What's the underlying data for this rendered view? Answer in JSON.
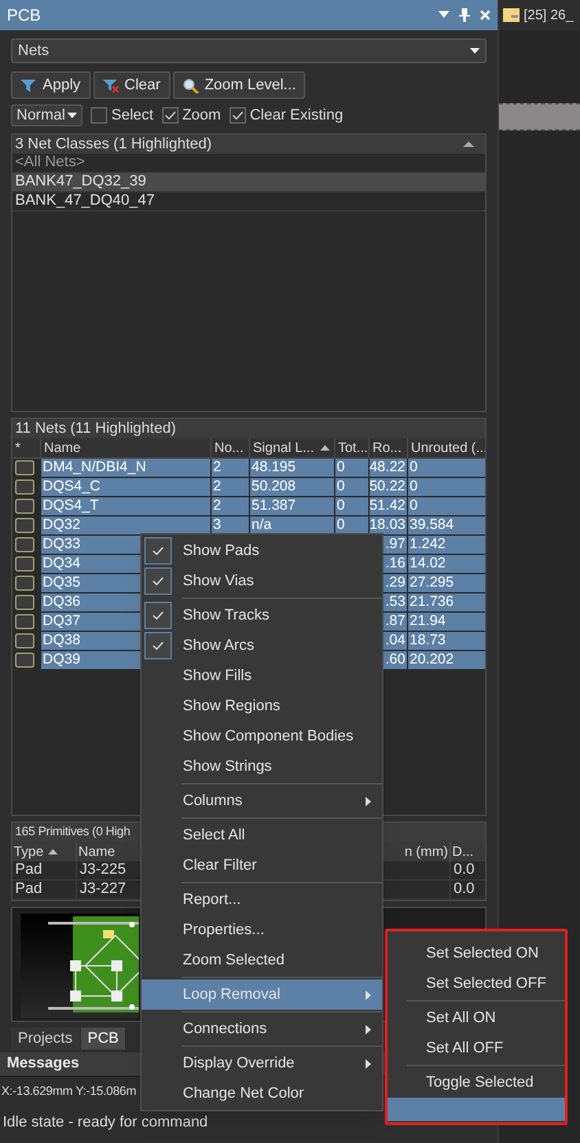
{
  "panel": {
    "title": "PCB"
  },
  "document_tab": {
    "label": "[25] 26_"
  },
  "mode_dropdown": {
    "value": "Nets"
  },
  "toolbar": [
    {
      "kind": "apply",
      "label": "Apply"
    },
    {
      "kind": "clear",
      "label": "Clear"
    },
    {
      "kind": "zoom",
      "label": "Zoom Level..."
    }
  ],
  "highlight_dropdown": {
    "value": "Normal"
  },
  "options": [
    {
      "label": "Select",
      "checked": false
    },
    {
      "label": "Zoom",
      "checked": true
    },
    {
      "label": "Clear Existing",
      "checked": true
    }
  ],
  "net_classes": {
    "header": "3 Net Classes (1 Highlighted)",
    "items": [
      {
        "label": "<All Nets>",
        "dimmed": true,
        "selected": false
      },
      {
        "label": "BANK47_DQ32_39",
        "dimmed": false,
        "selected": true
      },
      {
        "label": "BANK_47_DQ40_47",
        "dimmed": false,
        "selected": false
      }
    ]
  },
  "nets": {
    "header": "11 Nets (11 Highlighted)",
    "columns": [
      {
        "label": "*",
        "sorted": false
      },
      {
        "label": "Name",
        "sorted": false
      },
      {
        "label": "No...",
        "sorted": false
      },
      {
        "label": "Signal L...",
        "sorted": true
      },
      {
        "label": "Tot...",
        "sorted": false
      },
      {
        "label": "Ro...",
        "sorted": false
      },
      {
        "label": "Unrouted (...",
        "sorted": false
      }
    ],
    "rows": [
      {
        "name": "DM4_N/DBI4_N",
        "nodes": "2",
        "signal": "48.195",
        "total": "0",
        "ro": "48.22",
        "unrouted": "0",
        "selected": true
      },
      {
        "name": "DQS4_C",
        "nodes": "2",
        "signal": "50.208",
        "total": "0",
        "ro": "50.22",
        "unrouted": "0",
        "selected": true
      },
      {
        "name": "DQS4_T",
        "nodes": "2",
        "signal": "51.387",
        "total": "0",
        "ro": "51.42",
        "unrouted": "0",
        "selected": true
      },
      {
        "name": "DQ32",
        "nodes": "3",
        "signal": "n/a",
        "total": "0",
        "ro": "18.03",
        "unrouted": "39.584",
        "selected": true
      },
      {
        "name": "DQ33",
        "ro": ".97",
        "unrouted": "1.242",
        "selected": true
      },
      {
        "name": "DQ34",
        "ro": ".16",
        "unrouted": "14.02",
        "selected": true
      },
      {
        "name": "DQ35",
        "ro": ".29",
        "unrouted": "27.295",
        "selected": true
      },
      {
        "name": "DQ36",
        "ro": ".53",
        "unrouted": "21.736",
        "selected": true
      },
      {
        "name": "DQ37",
        "ro": ".87",
        "unrouted": "21.94",
        "selected": true
      },
      {
        "name": "DQ38",
        "ro": ".04",
        "unrouted": "18.73",
        "selected": true
      },
      {
        "name": "DQ39",
        "ro": ".60",
        "unrouted": "20.202",
        "selected": true
      }
    ]
  },
  "primitives": {
    "header": "165 Primitives (0 High",
    "columns": [
      {
        "label": "Type",
        "sorted": true
      },
      {
        "label": "Name",
        "sorted": false
      },
      {
        "label": "n (mm)",
        "sorted": false
      },
      {
        "label": "D...",
        "sorted": false
      }
    ],
    "rows": [
      {
        "type": "Pad",
        "name": "J3-225",
        "column_4": "0.0"
      },
      {
        "type": "Pad",
        "name": "J3-227",
        "column_4": "0.0"
      }
    ]
  },
  "bottom_tabs": [
    {
      "label": "Projects",
      "selected": false
    },
    {
      "label": "PCB",
      "selected": true
    }
  ],
  "messages_bar": {
    "title": "Messages"
  },
  "coordinates": "X:-13.629mm Y:-15.086m",
  "status": "Idle state - ready for command",
  "context_menu": [
    {
      "kind": "item",
      "label": "Show Pads",
      "checked": true,
      "has_submenu": false,
      "selected": false
    },
    {
      "kind": "item",
      "label": "Show Vias",
      "checked": true,
      "has_submenu": false,
      "selected": false
    },
    {
      "kind": "separator"
    },
    {
      "kind": "item",
      "label": "Show Tracks",
      "checked": true,
      "has_submenu": false,
      "selected": false
    },
    {
      "kind": "item",
      "label": "Show Arcs",
      "checked": true,
      "has_submenu": false,
      "selected": false
    },
    {
      "kind": "item",
      "label": "Show Fills",
      "checked": false,
      "has_submenu": false,
      "selected": false
    },
    {
      "kind": "item",
      "label": "Show Regions",
      "checked": false,
      "has_submenu": false,
      "selected": false
    },
    {
      "kind": "item",
      "label": "Show Component Bodies",
      "checked": false,
      "has_submenu": false,
      "selected": false
    },
    {
      "kind": "item",
      "label": "Show Strings",
      "checked": false,
      "has_submenu": false,
      "selected": false
    },
    {
      "kind": "separator"
    },
    {
      "kind": "item",
      "label": "Columns",
      "checked": false,
      "has_submenu": true,
      "selected": false
    },
    {
      "kind": "separator"
    },
    {
      "kind": "item",
      "label": "Select All",
      "checked": false,
      "has_submenu": false,
      "selected": false
    },
    {
      "kind": "item",
      "label": "Clear Filter",
      "checked": false,
      "has_submenu": false,
      "selected": false
    },
    {
      "kind": "separator"
    },
    {
      "kind": "item",
      "label": "Report...",
      "checked": false,
      "has_submenu": false,
      "selected": false
    },
    {
      "kind": "item",
      "label": "Properties...",
      "checked": false,
      "has_submenu": false,
      "selected": false
    },
    {
      "kind": "item",
      "label": "Zoom Selected",
      "checked": false,
      "has_submenu": false,
      "selected": false
    },
    {
      "kind": "separator"
    },
    {
      "kind": "item",
      "label": "Loop Removal",
      "checked": false,
      "has_submenu": true,
      "selected": true
    },
    {
      "kind": "separator"
    },
    {
      "kind": "item",
      "label": "Connections",
      "checked": false,
      "has_submenu": true,
      "selected": false
    },
    {
      "kind": "separator"
    },
    {
      "kind": "item",
      "label": "Display Override",
      "checked": false,
      "has_submenu": true,
      "selected": false
    },
    {
      "kind": "item",
      "label": "Change Net Color",
      "checked": false,
      "has_submenu": false,
      "selected": false
    }
  ],
  "submenu": [
    {
      "kind": "item",
      "label": "Set Selected ON",
      "selected": false
    },
    {
      "kind": "item",
      "label": "Set Selected OFF",
      "selected": false
    },
    {
      "kind": "separator"
    },
    {
      "kind": "item",
      "label": "Set All ON",
      "selected": false
    },
    {
      "kind": "item",
      "label": "Set All OFF",
      "selected": false
    },
    {
      "kind": "separator"
    },
    {
      "kind": "item",
      "label": "Toggle Selected",
      "selected": false
    },
    {
      "kind": "item",
      "selected": true
    }
  ]
}
